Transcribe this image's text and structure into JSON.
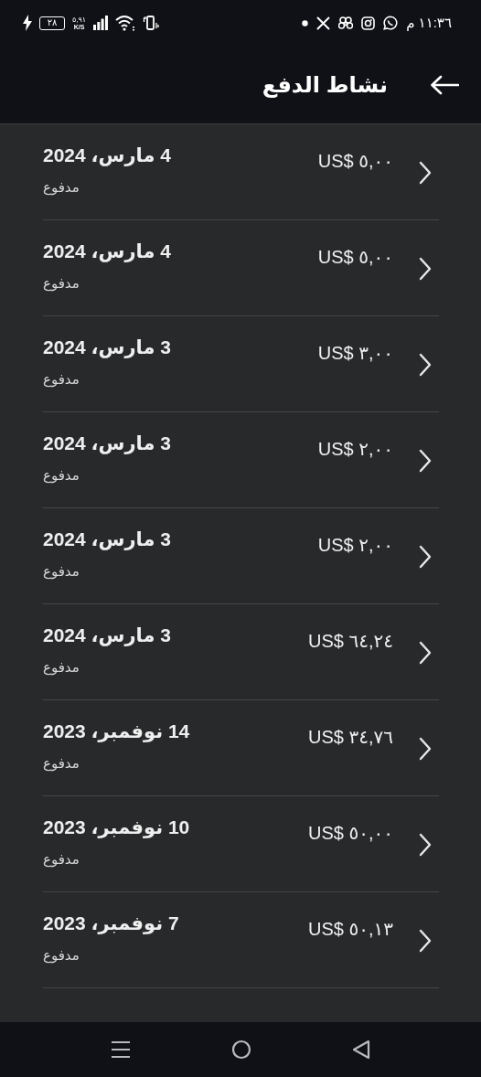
{
  "status_bar": {
    "battery": "٢٨",
    "net_speed": "٥,٩١",
    "net_unit": "K/S",
    "time": "١١:٣٦ م"
  },
  "header": {
    "title": "نشاط الدفع"
  },
  "payments": [
    {
      "date": "4 مارس، 2024",
      "status": "مدفوع",
      "amount": "US$ ٥,٠٠"
    },
    {
      "date": "4 مارس، 2024",
      "status": "مدفوع",
      "amount": "US$ ٥,٠٠"
    },
    {
      "date": "3 مارس، 2024",
      "status": "مدفوع",
      "amount": "US$ ٣,٠٠"
    },
    {
      "date": "3 مارس، 2024",
      "status": "مدفوع",
      "amount": "US$ ٢,٠٠"
    },
    {
      "date": "3 مارس، 2024",
      "status": "مدفوع",
      "amount": "US$ ٢,٠٠"
    },
    {
      "date": "3 مارس، 2024",
      "status": "مدفوع",
      "amount": "US$ ٦٤,٢٤"
    },
    {
      "date": "14 نوفمبر، 2023",
      "status": "مدفوع",
      "amount": "US$ ٣٤,٧٦"
    },
    {
      "date": "10 نوفمبر، 2023",
      "status": "مدفوع",
      "amount": "US$ ٥٠,٠٠"
    },
    {
      "date": "7 نوفمبر، 2023",
      "status": "مدفوع",
      "amount": "US$ ٥٠,١٣"
    }
  ]
}
